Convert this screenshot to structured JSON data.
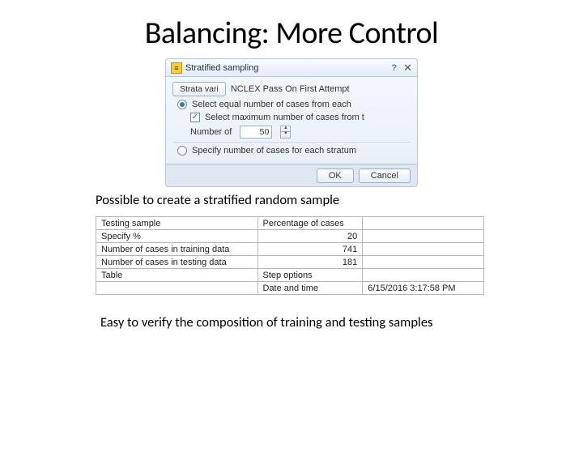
{
  "title": "Balancing: More Control",
  "dialog": {
    "title": "Stratified sampling",
    "strata_btn": "Strata vari",
    "strata_value": "NCLEX Pass On First Attempt",
    "radio1_label": "Select equal number of cases from each",
    "check1_label": "Select maximum number of cases  from t",
    "number_of_label": "Number of",
    "number_value": "50",
    "radio2_label": "Specify number of cases for each stratum",
    "ok": "OK",
    "cancel": "Cancel"
  },
  "caption1": "Possible to create a stratified random sample",
  "table": {
    "rows": [
      {
        "k": "Testing sample",
        "v": "Percentage of cases",
        "e": ""
      },
      {
        "k": "Specify %",
        "v": "20",
        "e": ""
      },
      {
        "k": "Number of cases in training data",
        "v": "741",
        "e": ""
      },
      {
        "k": "Number of cases in testing data",
        "v": "181",
        "e": ""
      },
      {
        "k": "Table",
        "v": "Step options",
        "e": ""
      },
      {
        "k": "",
        "v": "Date and time",
        "e": "6/15/2016 3:17:58 PM"
      }
    ]
  },
  "caption2": "Easy to verify the composition of training and testing samples"
}
